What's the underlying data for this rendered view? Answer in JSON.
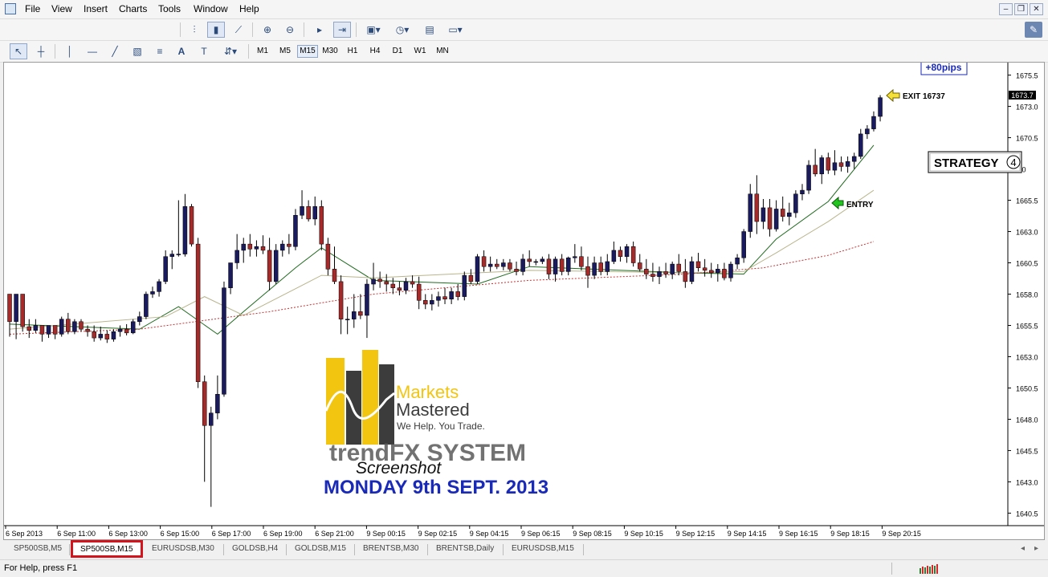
{
  "menu": {
    "items": [
      "File",
      "View",
      "Insert",
      "Charts",
      "Tools",
      "Window",
      "Help"
    ]
  },
  "toolbar": {
    "timeframes": [
      "M1",
      "M5",
      "M15",
      "M30",
      "H1",
      "H4",
      "D1",
      "W1",
      "MN"
    ],
    "active_timeframe": "M15"
  },
  "chart": {
    "price_axis_labels": [
      "1675.5",
      "1673.0",
      "1670.5",
      "8.0",
      "1665.5",
      "1663.0",
      "1660.5",
      "1658.0",
      "1655.5",
      "1653.0",
      "1650.5",
      "1648.0",
      "1645.5",
      "1643.0",
      "1640.5"
    ],
    "current_price_label": "1673.7",
    "time_axis_labels": [
      "6 Sep 2013",
      "6 Sep 11:00",
      "6 Sep 13:00",
      "6 Sep 15:00",
      "6 Sep 17:00",
      "6 Sep 19:00",
      "6 Sep 21:00",
      "9 Sep 00:15",
      "9 Sep 02:15",
      "9 Sep 04:15",
      "9 Sep 06:15",
      "9 Sep 08:15",
      "9 Sep 10:15",
      "9 Sep 12:15",
      "9 Sep 14:15",
      "9 Sep 16:15",
      "9 Sep 18:15",
      "9 Sep 20:15"
    ],
    "annotations": {
      "pips_label": "+80pips",
      "exit_label": "EXIT 16737",
      "entry_label": "ENTRY",
      "strategy_label": "STRATEGY",
      "strategy_number": "4"
    },
    "watermark": {
      "brand_line1": "Markets",
      "brand_line2": "Mastered",
      "tagline": "We Help. You Trade.",
      "system_name": "trendFX SYSTEM",
      "screenshot_label": "Screenshot",
      "date_label": "MONDAY 9th SEPT. 2013"
    },
    "colors": {
      "bull_candle": "#1a1a5e",
      "bear_candle": "#a52a2a",
      "fast_ma": "#1f6b1f",
      "slow_ma": "#b9b58c",
      "long_ma": "#c83030",
      "date_text": "#1a2ab8",
      "logo_yellow": "#f2c511",
      "logo_dark": "#3c3c3c"
    }
  },
  "chart_data": {
    "type": "candlestick",
    "symbol": "SP500SB",
    "timeframe": "M15",
    "ylim": [
      1639.5,
      1676.5
    ],
    "series": [
      {
        "type": "candlestick",
        "values": [
          [
            1658.0,
            1658.0,
            1654.6,
            1655.8
          ],
          [
            1655.8,
            1658.0,
            1654.4,
            1658.0
          ],
          [
            1658.0,
            1658.0,
            1655.0,
            1655.4
          ],
          [
            1655.4,
            1656.0,
            1654.5,
            1655.1
          ],
          [
            1655.1,
            1656.0,
            1654.9,
            1655.5
          ],
          [
            1655.5,
            1655.5,
            1654.2,
            1654.8
          ],
          [
            1654.8,
            1655.5,
            1654.5,
            1655.5
          ],
          [
            1655.5,
            1655.5,
            1654.4,
            1654.8
          ],
          [
            1654.8,
            1656.2,
            1654.6,
            1656.0
          ],
          [
            1656.0,
            1656.5,
            1654.8,
            1655.0
          ],
          [
            1655.0,
            1656.0,
            1654.8,
            1655.8
          ],
          [
            1655.8,
            1656.0,
            1655.0,
            1655.2
          ],
          [
            1655.2,
            1655.5,
            1654.6,
            1655.0
          ],
          [
            1655.0,
            1655.5,
            1654.2,
            1654.5
          ],
          [
            1654.5,
            1655.4,
            1654.3,
            1654.8
          ],
          [
            1654.8,
            1655.1,
            1654.1,
            1654.4
          ],
          [
            1654.4,
            1655.2,
            1654.2,
            1655.0
          ],
          [
            1655.0,
            1655.5,
            1654.6,
            1655.2
          ],
          [
            1655.2,
            1655.6,
            1654.7,
            1654.9
          ],
          [
            1654.9,
            1656.0,
            1654.8,
            1655.8
          ],
          [
            1655.8,
            1656.6,
            1655.5,
            1656.2
          ],
          [
            1656.2,
            1658.2,
            1656.0,
            1658.0
          ],
          [
            1658.0,
            1658.6,
            1657.7,
            1658.2
          ],
          [
            1658.2,
            1659.2,
            1657.8,
            1659.0
          ],
          [
            1659.0,
            1661.5,
            1658.8,
            1661.0
          ],
          [
            1661.0,
            1661.5,
            1660.0,
            1661.2
          ],
          [
            1661.2,
            1665.5,
            1661.0,
            1661.2
          ],
          [
            1661.2,
            1666.0,
            1661.0,
            1665.0
          ],
          [
            1665.0,
            1665.2,
            1661.8,
            1662.0
          ],
          [
            1662.0,
            1662.5,
            1650.5,
            1651.0
          ],
          [
            1651.0,
            1651.5,
            1643.0,
            1647.5
          ],
          [
            1647.5,
            1649.0,
            1641.0,
            1648.5
          ],
          [
            1648.5,
            1651.5,
            1648.0,
            1650.0
          ],
          [
            1650.0,
            1659.0,
            1649.8,
            1658.5
          ],
          [
            1658.5,
            1660.5,
            1658.0,
            1660.5
          ],
          [
            1660.5,
            1662.8,
            1660.0,
            1661.5
          ],
          [
            1661.5,
            1662.5,
            1660.5,
            1662.0
          ],
          [
            1662.0,
            1662.8,
            1661.0,
            1661.6
          ],
          [
            1661.6,
            1662.3,
            1661.0,
            1661.8
          ],
          [
            1661.8,
            1662.7,
            1661.2,
            1661.5
          ],
          [
            1661.5,
            1662.5,
            1658.3,
            1659.0
          ],
          [
            1659.0,
            1662.0,
            1658.8,
            1661.5
          ],
          [
            1661.5,
            1662.3,
            1661.0,
            1662.0
          ],
          [
            1662.0,
            1662.8,
            1661.2,
            1661.8
          ],
          [
            1661.8,
            1664.8,
            1661.5,
            1664.3
          ],
          [
            1664.3,
            1666.3,
            1664.0,
            1665.0
          ],
          [
            1665.0,
            1665.5,
            1663.8,
            1664.0
          ],
          [
            1664.0,
            1665.8,
            1663.5,
            1665.0
          ],
          [
            1665.0,
            1665.5,
            1661.5,
            1662.0
          ],
          [
            1662.0,
            1662.5,
            1659.5,
            1660.0
          ],
          [
            1660.0,
            1661.8,
            1658.8,
            1659.0
          ],
          [
            1659.0,
            1659.5,
            1654.8,
            1656.0
          ],
          [
            1656.0,
            1657.0,
            1654.8,
            1656.0
          ],
          [
            1656.0,
            1658.0,
            1655.3,
            1656.6
          ],
          [
            1656.6,
            1658.0,
            1656.0,
            1656.3
          ],
          [
            1656.3,
            1659.2,
            1654.5,
            1658.8
          ],
          [
            1658.8,
            1660.5,
            1658.3,
            1659.2
          ],
          [
            1659.2,
            1659.8,
            1658.5,
            1659.0
          ],
          [
            1659.0,
            1659.6,
            1658.2,
            1658.8
          ],
          [
            1658.8,
            1659.3,
            1658.0,
            1658.5
          ],
          [
            1658.5,
            1659.0,
            1657.9,
            1658.3
          ],
          [
            1658.3,
            1659.3,
            1658.0,
            1659.0
          ],
          [
            1659.0,
            1659.5,
            1658.5,
            1658.8
          ],
          [
            1658.8,
            1659.4,
            1656.8,
            1657.5
          ],
          [
            1657.5,
            1658.0,
            1656.8,
            1657.2
          ],
          [
            1657.2,
            1658.0,
            1656.7,
            1657.5
          ],
          [
            1657.5,
            1658.2,
            1657.0,
            1657.8
          ],
          [
            1657.8,
            1658.5,
            1657.2,
            1657.6
          ],
          [
            1657.6,
            1658.5,
            1657.2,
            1658.2
          ],
          [
            1658.2,
            1658.8,
            1657.5,
            1657.8
          ],
          [
            1657.8,
            1659.8,
            1657.5,
            1659.5
          ],
          [
            1659.5,
            1660.0,
            1658.8,
            1659.0
          ],
          [
            1659.0,
            1661.2,
            1658.8,
            1661.0
          ],
          [
            1661.0,
            1661.5,
            1659.8,
            1660.2
          ],
          [
            1660.2,
            1661.0,
            1659.8,
            1660.4
          ],
          [
            1660.4,
            1660.8,
            1660.0,
            1660.2
          ],
          [
            1660.2,
            1660.8,
            1659.9,
            1660.5
          ],
          [
            1660.5,
            1660.8,
            1659.8,
            1660.0
          ],
          [
            1660.0,
            1660.6,
            1659.5,
            1659.8
          ],
          [
            1659.8,
            1661.2,
            1659.5,
            1660.8
          ],
          [
            1660.8,
            1661.5,
            1660.2,
            1660.6
          ],
          [
            1660.6,
            1660.8,
            1660.3,
            1660.6
          ],
          [
            1660.6,
            1661.0,
            1660.4,
            1660.8
          ],
          [
            1660.8,
            1661.2,
            1659.2,
            1659.6
          ],
          [
            1659.6,
            1661.0,
            1659.0,
            1660.8
          ],
          [
            1660.8,
            1661.2,
            1659.5,
            1659.8
          ],
          [
            1659.8,
            1661.0,
            1659.5,
            1660.9
          ],
          [
            1660.9,
            1662.0,
            1660.5,
            1661.0
          ],
          [
            1661.0,
            1661.8,
            1659.9,
            1660.2
          ],
          [
            1660.2,
            1661.0,
            1658.5,
            1659.5
          ],
          [
            1659.5,
            1661.0,
            1659.2,
            1660.5
          ],
          [
            1660.5,
            1661.0,
            1659.5,
            1659.8
          ],
          [
            1659.8,
            1661.2,
            1659.5,
            1660.6
          ],
          [
            1660.6,
            1662.2,
            1660.4,
            1661.5
          ],
          [
            1661.5,
            1661.8,
            1660.6,
            1661.0
          ],
          [
            1661.0,
            1662.0,
            1660.5,
            1661.8
          ],
          [
            1661.8,
            1662.2,
            1660.2,
            1660.5
          ],
          [
            1660.5,
            1661.2,
            1659.8,
            1660.0
          ],
          [
            1660.0,
            1660.8,
            1659.2,
            1659.6
          ],
          [
            1659.6,
            1660.5,
            1659.0,
            1659.4
          ],
          [
            1659.4,
            1660.2,
            1658.8,
            1659.8
          ],
          [
            1659.8,
            1660.5,
            1659.3,
            1659.6
          ],
          [
            1659.6,
            1660.6,
            1659.2,
            1660.4
          ],
          [
            1660.4,
            1661.2,
            1659.5,
            1659.8
          ],
          [
            1659.8,
            1660.8,
            1658.5,
            1659.0
          ],
          [
            1659.0,
            1661.0,
            1658.8,
            1660.6
          ],
          [
            1660.6,
            1661.3,
            1659.8,
            1660.1
          ],
          [
            1660.1,
            1660.8,
            1659.4,
            1659.9
          ],
          [
            1659.9,
            1660.5,
            1659.3,
            1659.7
          ],
          [
            1659.7,
            1660.4,
            1659.0,
            1660.0
          ],
          [
            1660.0,
            1660.5,
            1659.1,
            1659.3
          ],
          [
            1659.3,
            1660.6,
            1659.0,
            1660.4
          ],
          [
            1660.4,
            1661.2,
            1660.0,
            1660.9
          ],
          [
            1660.9,
            1663.2,
            1660.5,
            1663.0
          ],
          [
            1663.0,
            1666.8,
            1662.5,
            1666.0
          ],
          [
            1666.0,
            1667.5,
            1662.8,
            1663.8
          ],
          [
            1663.8,
            1665.6,
            1663.2,
            1664.9
          ],
          [
            1664.9,
            1665.6,
            1662.6,
            1663.2
          ],
          [
            1663.2,
            1665.5,
            1663.0,
            1664.8
          ],
          [
            1664.8,
            1665.8,
            1663.8,
            1664.2
          ],
          [
            1664.2,
            1665.3,
            1663.5,
            1664.5
          ],
          [
            1664.5,
            1666.3,
            1664.1,
            1666.0
          ],
          [
            1666.0,
            1666.8,
            1665.5,
            1666.3
          ],
          [
            1666.3,
            1668.7,
            1666.0,
            1668.3
          ],
          [
            1668.3,
            1669.6,
            1667.4,
            1667.6
          ],
          [
            1667.6,
            1669.1,
            1666.8,
            1668.9
          ],
          [
            1668.9,
            1669.3,
            1667.6,
            1667.9
          ],
          [
            1667.9,
            1669.5,
            1667.5,
            1668.5
          ],
          [
            1668.5,
            1669.0,
            1667.8,
            1668.2
          ],
          [
            1668.2,
            1669.0,
            1667.7,
            1668.6
          ],
          [
            1668.6,
            1669.3,
            1668.0,
            1669.0
          ],
          [
            1669.0,
            1671.2,
            1668.8,
            1670.8
          ],
          [
            1670.8,
            1671.5,
            1670.4,
            1671.2
          ],
          [
            1671.2,
            1672.6,
            1671.0,
            1672.2
          ],
          [
            1672.2,
            1673.9,
            1671.8,
            1673.7
          ]
        ]
      },
      {
        "name": "",
        "type": "line",
        "role": "fast_ma",
        "values": [
          [
            0,
            1655.6
          ],
          [
            20,
            1655.2
          ],
          [
            26,
            1657.0
          ],
          [
            32,
            1654.8
          ],
          [
            36,
            1656.6
          ],
          [
            44,
            1660.1
          ],
          [
            48,
            1661.7
          ],
          [
            56,
            1659.1
          ],
          [
            72,
            1658.8
          ],
          [
            80,
            1660.2
          ],
          [
            104,
            1659.7
          ],
          [
            113,
            1659.6
          ],
          [
            118,
            1662.4
          ],
          [
            126,
            1665.4
          ],
          [
            133,
            1669.9
          ]
        ]
      },
      {
        "name": "",
        "type": "line",
        "role": "slow_ma",
        "values": [
          [
            0,
            1655.2
          ],
          [
            24,
            1656.2
          ],
          [
            30,
            1657.8
          ],
          [
            36,
            1656.3
          ],
          [
            48,
            1659.5
          ],
          [
            56,
            1659.3
          ],
          [
            80,
            1659.9
          ],
          [
            104,
            1659.7
          ],
          [
            113,
            1659.8
          ],
          [
            118,
            1661.3
          ],
          [
            126,
            1663.8
          ],
          [
            133,
            1666.3
          ]
        ]
      },
      {
        "name": "",
        "type": "line",
        "role": "long_ma",
        "values": [
          [
            0,
            1654.8
          ],
          [
            20,
            1655.2
          ],
          [
            40,
            1656.6
          ],
          [
            56,
            1658.0
          ],
          [
            80,
            1659.1
          ],
          [
            104,
            1659.6
          ],
          [
            116,
            1660.1
          ],
          [
            126,
            1661.1
          ],
          [
            133,
            1662.2
          ]
        ]
      }
    ]
  },
  "tabs": {
    "items": [
      "SP500SB,M5",
      "SP500SB,M15",
      "EURUSDSB,M30",
      "GOLDSB,H4",
      "GOLDSB,M15",
      "BRENTSB,M30",
      "BRENTSB,Daily",
      "EURUSDSB,M15"
    ],
    "active": "SP500SB,M15"
  },
  "status": {
    "help_text": "For Help, press F1"
  }
}
